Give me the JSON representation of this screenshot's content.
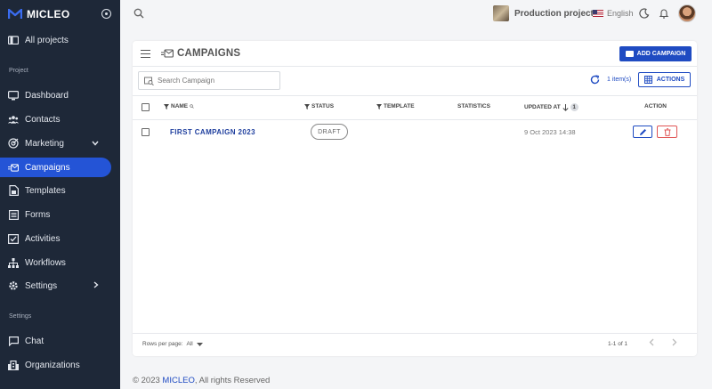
{
  "brand": {
    "name": "MICLEO",
    "color": "#2454d6"
  },
  "sidebar": {
    "items": [
      {
        "label": "All projects",
        "icon": "folder-icon"
      },
      {
        "label": "Dashboard",
        "icon": "monitor-icon"
      },
      {
        "label": "Contacts",
        "icon": "users-icon"
      },
      {
        "label": "Marketing",
        "icon": "target-icon"
      },
      {
        "label": "Campaigns",
        "icon": "campaign-mail-icon"
      },
      {
        "label": "Templates",
        "icon": "template-icon"
      },
      {
        "label": "Forms",
        "icon": "form-icon"
      },
      {
        "label": "Activities",
        "icon": "checklist-icon"
      },
      {
        "label": "Workflows",
        "icon": "workflow-icon"
      },
      {
        "label": "Settings",
        "icon": "gear-icon"
      },
      {
        "label": "Chat",
        "icon": "chat-icon"
      },
      {
        "label": "Organizations",
        "icon": "building-icon"
      }
    ],
    "section_project": "Project",
    "section_settings": "Settings"
  },
  "topbar": {
    "project_name": "Production project",
    "language": "English"
  },
  "card": {
    "title": "CAMPAIGNS",
    "add_button": "ADD CAMPAIGN",
    "search_placeholder": "Search Campaign",
    "count": "1 item(s)",
    "actions_button": "ACTIONS"
  },
  "table": {
    "headers": {
      "name": "NAME",
      "status": "STATUS",
      "template": "TEMPLATE",
      "statistics": "STATISTICS",
      "updated_at": "UPDATED AT",
      "updated_sort_rank": "1",
      "action": "ACTION"
    },
    "rows": [
      {
        "name": "FIRST CAMPAIGN 2023",
        "status": "DRAFT",
        "template": "",
        "statistics": "",
        "updated_at": "9 Oct 2023 14:38"
      }
    ]
  },
  "pagination": {
    "rows_per_page_label": "Rows per page:",
    "rows_per_page_value": "All",
    "range": "1-1 of 1"
  },
  "footer": {
    "prefix": "© 2023",
    "brand": "MICLEO",
    "suffix": ", All rights Reserved"
  }
}
